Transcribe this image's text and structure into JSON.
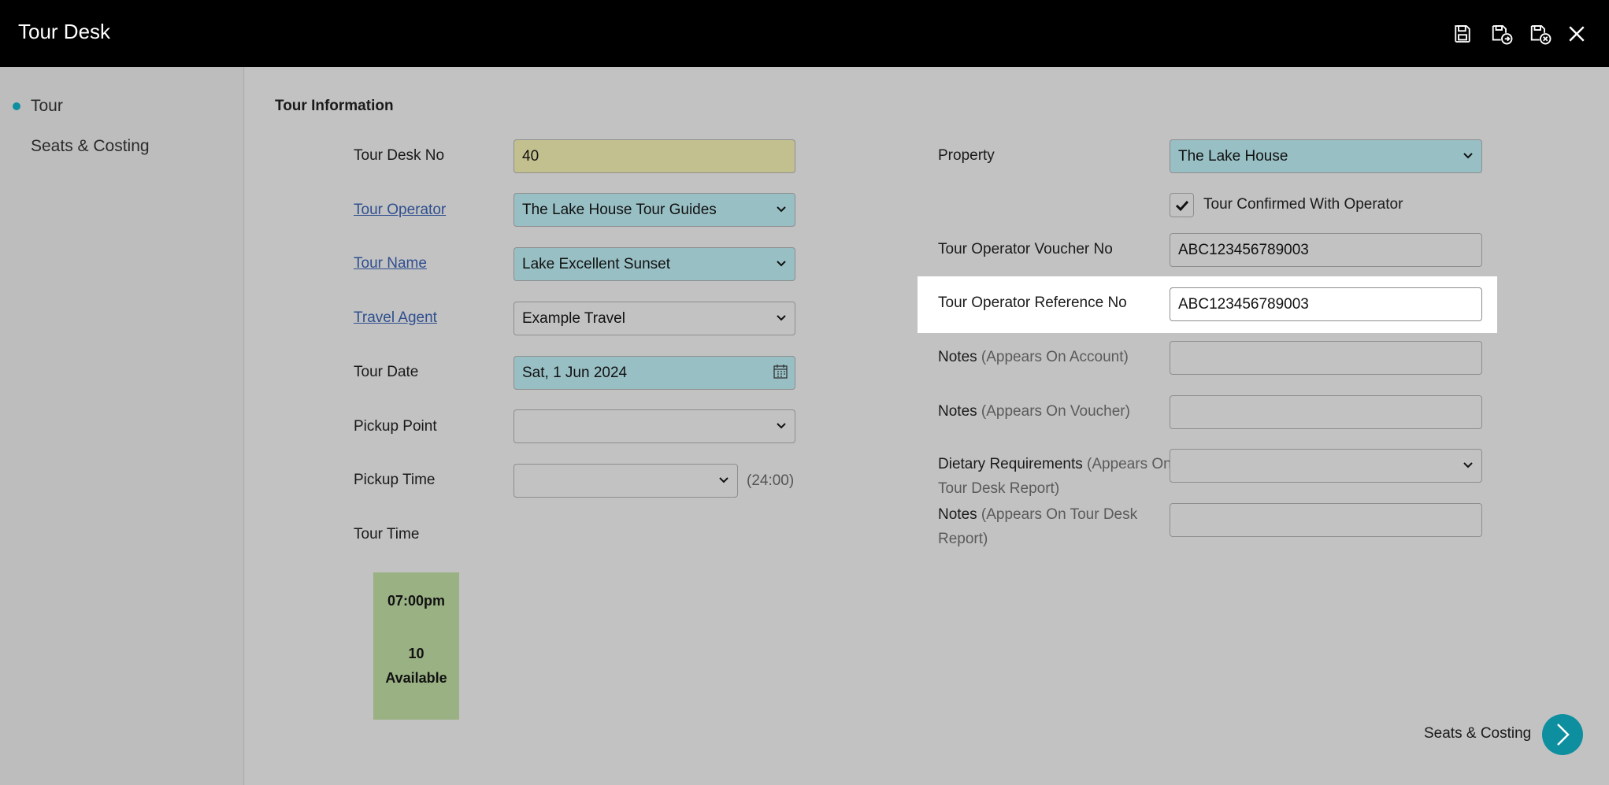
{
  "app": {
    "title": "Tour Desk"
  },
  "toolbar": {
    "save_icon": "save-icon",
    "save_new_icon": "save-and-new-icon",
    "save_close_icon": "save-and-close-icon",
    "close_icon": "close-icon"
  },
  "sidebar": {
    "items": [
      {
        "label": "Tour",
        "active": true
      },
      {
        "label": "Seats & Costing",
        "active": false
      }
    ]
  },
  "section": {
    "title": "Tour Information"
  },
  "left": {
    "tour_desk_no": {
      "label": "Tour Desk No",
      "value": "40"
    },
    "tour_operator": {
      "label": "Tour Operator",
      "value": "The Lake House Tour Guides"
    },
    "tour_name": {
      "label": "Tour Name",
      "value": "Lake Excellent Sunset"
    },
    "travel_agent": {
      "label": "Travel Agent",
      "value": "Example Travel"
    },
    "tour_date": {
      "label": "Tour Date",
      "value": "Sat, 1 Jun 2024"
    },
    "pickup_point": {
      "label": "Pickup Point",
      "value": ""
    },
    "pickup_time": {
      "label": "Pickup Time",
      "value": "",
      "hint": "(24:00)"
    },
    "tour_time": {
      "label": "Tour Time"
    }
  },
  "timecard": {
    "time": "07:00pm",
    "count": "10",
    "status": "Available"
  },
  "right": {
    "property": {
      "label": "Property",
      "value": "The Lake House"
    },
    "confirmed": {
      "label": "Tour Confirmed With Operator",
      "checked": true
    },
    "voucher_no": {
      "label": "Tour Operator Voucher No",
      "value": "ABC123456789003"
    },
    "reference_no": {
      "label": "Tour Operator Reference No",
      "value": "ABC123456789003"
    },
    "notes_account": {
      "label": "Notes",
      "sub": "(Appears On Account)",
      "value": ""
    },
    "notes_voucher": {
      "label": "Notes",
      "sub": "(Appears On Voucher)",
      "value": ""
    },
    "dietary": {
      "label": "Dietary Requirements",
      "sub1": "(Appears On",
      "sub2": "Tour Desk Report)",
      "value": ""
    },
    "notes_report": {
      "label": "Notes",
      "sub1": "(Appears On Tour Desk",
      "sub2": "Report)",
      "value": ""
    }
  },
  "footer": {
    "next_label": "Seats & Costing",
    "next_icon": "chevron-right-icon"
  },
  "colors": {
    "accent": "#0e8fa0",
    "required": "#98bfc4",
    "readonly": "#c3c08f",
    "timecard": "#9ab184"
  }
}
